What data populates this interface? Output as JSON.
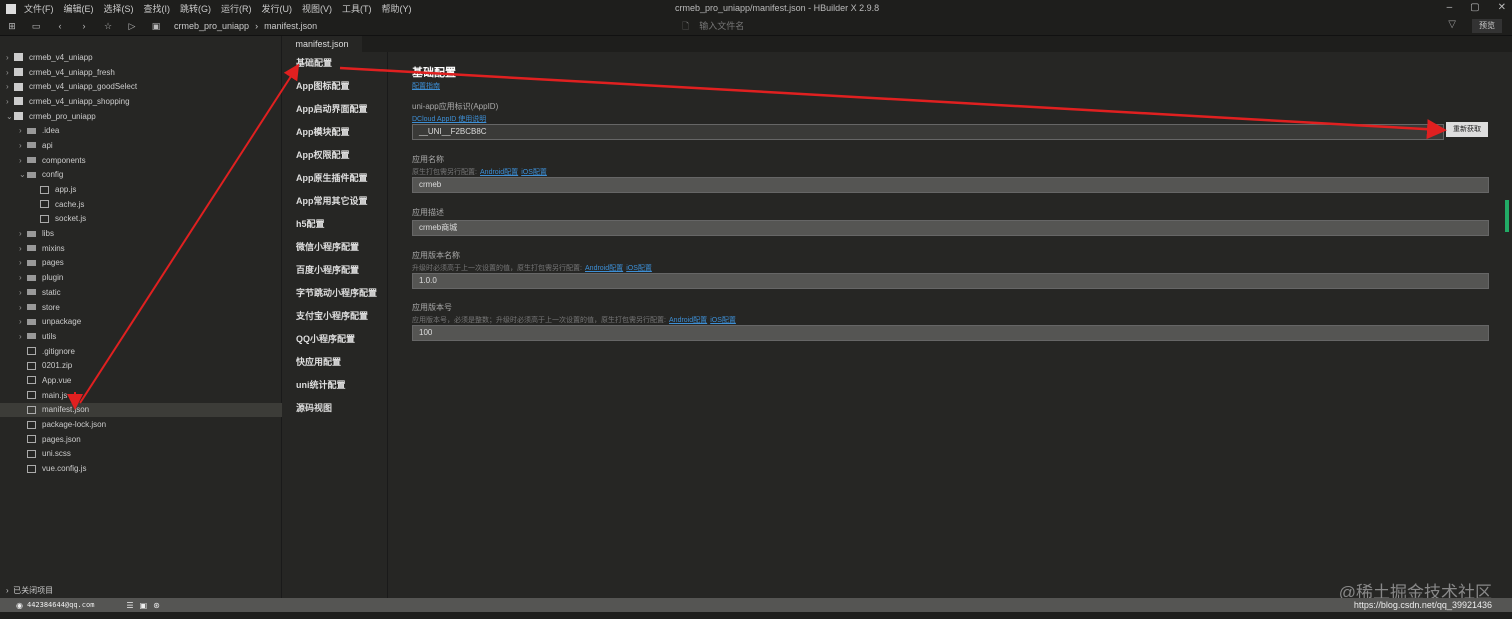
{
  "window": {
    "title": "crmeb_pro_uniapp/manifest.json - HBuilder X 2.9.8",
    "menu": [
      "文件(F)",
      "编辑(E)",
      "选择(S)",
      "查找(I)",
      "跳转(G)",
      "运行(R)",
      "发行(U)",
      "视图(V)",
      "工具(T)",
      "帮助(Y)"
    ]
  },
  "toolbar": {
    "breadcrumb": [
      "crmeb_pro_uniapp",
      "manifest.json"
    ],
    "search_placeholder": "输入文件名",
    "preview": "预览"
  },
  "tree": [
    {
      "label": "crmeb_v4_uniapp",
      "type": "project",
      "depth": 0,
      "arrow": "›"
    },
    {
      "label": "crmeb_v4_uniapp_fresh",
      "type": "project",
      "depth": 0,
      "arrow": "›"
    },
    {
      "label": "crmeb_v4_uniapp_goodSelect",
      "type": "project",
      "depth": 0,
      "arrow": "›"
    },
    {
      "label": "crmeb_v4_uniapp_shopping",
      "type": "project",
      "depth": 0,
      "arrow": "›"
    },
    {
      "label": "crmeb_pro_uniapp",
      "type": "project",
      "depth": 0,
      "arrow": "⌄"
    },
    {
      "label": ".idea",
      "type": "folder",
      "depth": 1,
      "arrow": "›"
    },
    {
      "label": "api",
      "type": "folder",
      "depth": 1,
      "arrow": "›"
    },
    {
      "label": "components",
      "type": "folder",
      "depth": 1,
      "arrow": "›"
    },
    {
      "label": "config",
      "type": "folder",
      "depth": 1,
      "arrow": "⌄"
    },
    {
      "label": "app.js",
      "type": "file",
      "depth": 2,
      "arrow": ""
    },
    {
      "label": "cache.js",
      "type": "file",
      "depth": 2,
      "arrow": ""
    },
    {
      "label": "socket.js",
      "type": "file",
      "depth": 2,
      "arrow": ""
    },
    {
      "label": "libs",
      "type": "folder",
      "depth": 1,
      "arrow": "›"
    },
    {
      "label": "mixins",
      "type": "folder",
      "depth": 1,
      "arrow": "›"
    },
    {
      "label": "pages",
      "type": "folder",
      "depth": 1,
      "arrow": "›"
    },
    {
      "label": "plugin",
      "type": "folder",
      "depth": 1,
      "arrow": "›"
    },
    {
      "label": "static",
      "type": "folder",
      "depth": 1,
      "arrow": "›"
    },
    {
      "label": "store",
      "type": "folder",
      "depth": 1,
      "arrow": "›"
    },
    {
      "label": "unpackage",
      "type": "folder",
      "depth": 1,
      "arrow": "›"
    },
    {
      "label": "utils",
      "type": "folder",
      "depth": 1,
      "arrow": "›"
    },
    {
      "label": ".gitignore",
      "type": "file",
      "depth": 1,
      "arrow": ""
    },
    {
      "label": "0201.zip",
      "type": "file",
      "depth": 1,
      "arrow": ""
    },
    {
      "label": "App.vue",
      "type": "file",
      "depth": 1,
      "arrow": ""
    },
    {
      "label": "main.js",
      "type": "file",
      "depth": 1,
      "arrow": ""
    },
    {
      "label": "manifest.json",
      "type": "file",
      "depth": 1,
      "arrow": "",
      "selected": true
    },
    {
      "label": "package-lock.json",
      "type": "file",
      "depth": 1,
      "arrow": ""
    },
    {
      "label": "pages.json",
      "type": "file",
      "depth": 1,
      "arrow": ""
    },
    {
      "label": "uni.scss",
      "type": "file",
      "depth": 1,
      "arrow": ""
    },
    {
      "label": "vue.config.js",
      "type": "file",
      "depth": 1,
      "arrow": ""
    }
  ],
  "sidebar": {
    "closed_projects": "已关闭项目"
  },
  "tab": "manifest.json",
  "nav": [
    "基础配置",
    "App图标配置",
    "App启动界面配置",
    "App模块配置",
    "App权限配置",
    "App原生插件配置",
    "App常用其它设置",
    "h5配置",
    "微信小程序配置",
    "百度小程序配置",
    "字节跳动小程序配置",
    "支付宝小程序配置",
    "QQ小程序配置",
    "快应用配置",
    "uni统计配置",
    "源码视图"
  ],
  "content": {
    "title": "基础配置",
    "guide_link": "配置指南",
    "appid": {
      "label": "uni-app应用标识(AppID)",
      "link": "DCloud AppID 使用说明",
      "value": "__UNI__F2BCB8C",
      "button": "重新获取"
    },
    "name": {
      "label": "应用名称",
      "desc": "原生打包需另行配置:",
      "android": "Android配置",
      "ios": "iOS配置",
      "value": "crmeb"
    },
    "description": {
      "label": "应用描述",
      "value": "crmeb商城"
    },
    "version_name": {
      "label": "应用版本名称",
      "desc": "升级时必须高于上一次设置的值，原生打包需另行配置:",
      "android": "Android配置",
      "ios": "iOS配置",
      "value": "1.0.0"
    },
    "version_code": {
      "label": "应用版本号",
      "desc": "应用版本号，必须是整数；升级时必须高于上一次设置的值，原生打包需另行配置:",
      "android": "Android配置",
      "ios": "iOS配置",
      "value": "100"
    }
  },
  "status": {
    "user": "442384644@qq.com",
    "url": "https://blog.csdn.net/qq_39921436"
  },
  "watermark": "@稀土掘金技术社区",
  "colors": {
    "accent": "#3d8fd6",
    "arrow": "#e02020"
  }
}
